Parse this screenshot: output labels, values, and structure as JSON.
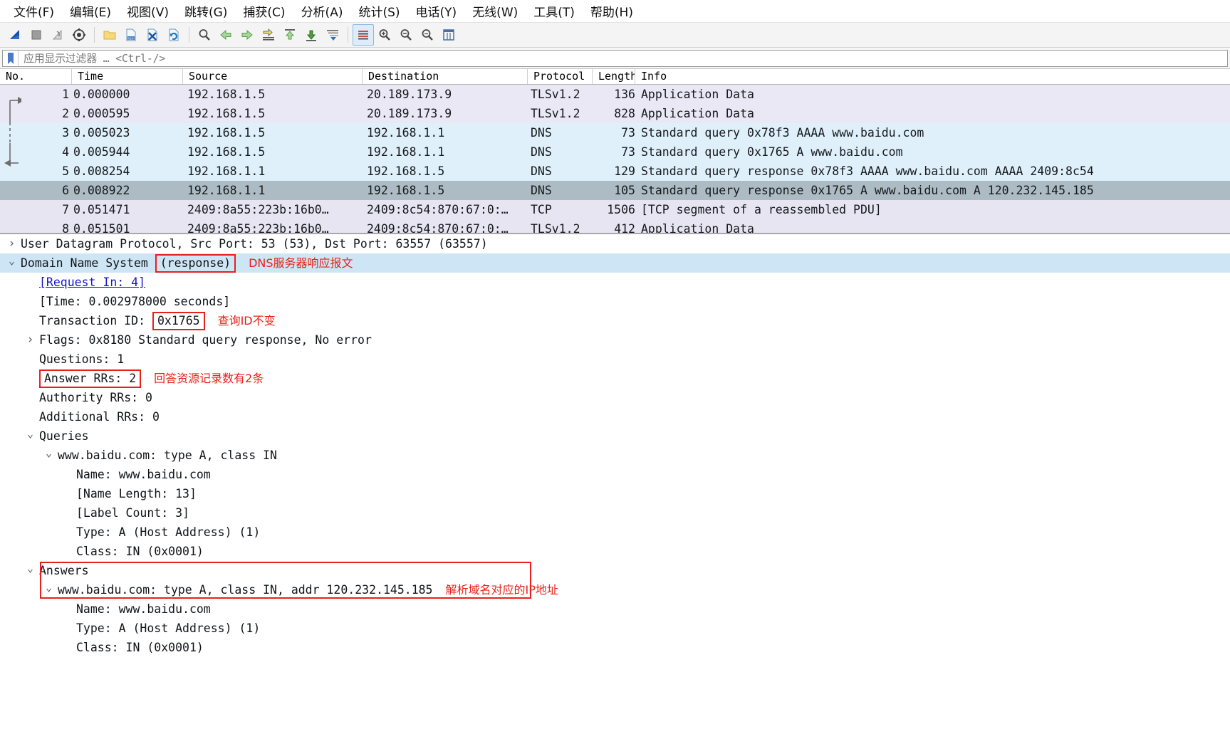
{
  "menu": {
    "items": [
      {
        "label": "文件(F)",
        "name": "menu-file"
      },
      {
        "label": "编辑(E)",
        "name": "menu-edit"
      },
      {
        "label": "视图(V)",
        "name": "menu-view"
      },
      {
        "label": "跳转(G)",
        "name": "menu-go"
      },
      {
        "label": "捕获(C)",
        "name": "menu-capture"
      },
      {
        "label": "分析(A)",
        "name": "menu-analyze"
      },
      {
        "label": "统计(S)",
        "name": "menu-statistics"
      },
      {
        "label": "电话(Y)",
        "name": "menu-telephony"
      },
      {
        "label": "无线(W)",
        "name": "menu-wireless"
      },
      {
        "label": "工具(T)",
        "name": "menu-tools"
      },
      {
        "label": "帮助(H)",
        "name": "menu-help"
      }
    ]
  },
  "toolbar": {
    "icons": [
      "start-capture-icon",
      "stop-capture-icon",
      "restart-capture-icon",
      "capture-options-icon",
      "open-file-icon",
      "save-file-icon",
      "close-file-icon",
      "reload-file-icon",
      "find-packet-icon",
      "go-back-icon",
      "go-forward-icon",
      "go-to-packet-icon",
      "go-first-packet-icon",
      "go-last-packet-icon",
      "auto-scroll-icon",
      "colorize-icon",
      "zoom-in-icon",
      "zoom-out-icon",
      "zoom-reset-icon",
      "resize-columns-icon"
    ]
  },
  "filter": {
    "placeholder": "应用显示过滤器 … <Ctrl-/>",
    "value": "",
    "bookmark_icon": "bookmark-icon"
  },
  "packet_list": {
    "columns": [
      "No.",
      "Time",
      "Source",
      "Destination",
      "Protocol",
      "Length",
      "Info"
    ],
    "rows": [
      {
        "no": "1",
        "time": "0.000000",
        "src": "192.168.1.5",
        "dst": "20.189.173.9",
        "proto": "TLSv1.2",
        "len": "136",
        "info": "Application Data",
        "style": "tls"
      },
      {
        "no": "2",
        "time": "0.000595",
        "src": "192.168.1.5",
        "dst": "20.189.173.9",
        "proto": "TLSv1.2",
        "len": "828",
        "info": "Application Data",
        "style": "tls"
      },
      {
        "no": "3",
        "time": "0.005023",
        "src": "192.168.1.5",
        "dst": "192.168.1.1",
        "proto": "DNS",
        "len": "73",
        "info": "Standard query 0x78f3 AAAA www.baidu.com",
        "style": "dns"
      },
      {
        "no": "4",
        "time": "0.005944",
        "src": "192.168.1.5",
        "dst": "192.168.1.1",
        "proto": "DNS",
        "len": "73",
        "info": "Standard query 0x1765 A www.baidu.com",
        "style": "dns"
      },
      {
        "no": "5",
        "time": "0.008254",
        "src": "192.168.1.1",
        "dst": "192.168.1.5",
        "proto": "DNS",
        "len": "129",
        "info": "Standard query response 0x78f3 AAAA www.baidu.com AAAA 2409:8c54",
        "style": "dns"
      },
      {
        "no": "6",
        "time": "0.008922",
        "src": "192.168.1.1",
        "dst": "192.168.1.5",
        "proto": "DNS",
        "len": "105",
        "info": "Standard query response 0x1765 A www.baidu.com A 120.232.145.185",
        "style": "sel"
      },
      {
        "no": "7",
        "time": "0.051471",
        "src": "2409:8a55:223b:16b0…",
        "dst": "2409:8c54:870:67:0:…",
        "proto": "TCP",
        "len": "1506",
        "info": "[TCP segment of a reassembled PDU]",
        "style": "tcp"
      },
      {
        "no": "8",
        "time": "0.051501",
        "src": "2409:8a55:223b:16b0…",
        "dst": "2409:8c54:870:67:0:…",
        "proto": "TLSv1.2",
        "len": "412",
        "info": "Application Data",
        "style": "tcp"
      }
    ]
  },
  "detail": {
    "rows": [
      {
        "indent": 0,
        "twisty": "›",
        "text": "User Datagram Protocol, Src Port: 53 (53), Dst Port: 63557 (63557)",
        "name": "detail-udp"
      },
      {
        "indent": 0,
        "twisty": "⌄",
        "text": "Domain Name System ",
        "boxed": "(response)",
        "annot": "DNS服务器响应报文",
        "selected": true,
        "name": "detail-dns"
      },
      {
        "indent": 1,
        "twisty": "",
        "text": "[Request In: 4]",
        "link": true,
        "name": "detail-request-in"
      },
      {
        "indent": 1,
        "twisty": "",
        "text": "[Time: 0.002978000 seconds]",
        "name": "detail-time"
      },
      {
        "indent": 1,
        "twisty": "",
        "text": "Transaction ID: ",
        "boxed": "0x1765",
        "annot": "查询ID不变",
        "name": "detail-transaction-id"
      },
      {
        "indent": 1,
        "twisty": "›",
        "text": "Flags: 0x8180 Standard query response, No error",
        "name": "detail-flags"
      },
      {
        "indent": 1,
        "twisty": "",
        "text": "Questions: 1",
        "name": "detail-questions"
      },
      {
        "indent": 1,
        "twisty": "",
        "boxed_full": "Answer RRs: 2",
        "annot": "回答资源记录数有2条",
        "name": "detail-answer-rrs"
      },
      {
        "indent": 1,
        "twisty": "",
        "text": "Authority RRs: 0",
        "name": "detail-authority-rrs"
      },
      {
        "indent": 1,
        "twisty": "",
        "text": "Additional RRs: 0",
        "name": "detail-additional-rrs"
      },
      {
        "indent": 1,
        "twisty": "⌄",
        "text": "Queries",
        "name": "detail-queries"
      },
      {
        "indent": 2,
        "twisty": "⌄",
        "text": "www.baidu.com: type A, class IN",
        "name": "detail-query-entry"
      },
      {
        "indent": 3,
        "twisty": "",
        "text": "Name: www.baidu.com",
        "name": "detail-query-name"
      },
      {
        "indent": 3,
        "twisty": "",
        "text": "[Name Length: 13]",
        "name": "detail-query-name-length"
      },
      {
        "indent": 3,
        "twisty": "",
        "text": "[Label Count: 3]",
        "name": "detail-query-label-count"
      },
      {
        "indent": 3,
        "twisty": "",
        "text": "Type: A (Host Address) (1)",
        "name": "detail-query-type"
      },
      {
        "indent": 3,
        "twisty": "",
        "text": "Class: IN (0x0001)",
        "name": "detail-query-class"
      },
      {
        "indent": 1,
        "twisty": "⌄",
        "text": "Answers",
        "annot": "",
        "name": "detail-answers"
      },
      {
        "indent": 2,
        "twisty": "⌄",
        "text": "www.baidu.com: type A, class IN, addr 120.232.145.185",
        "annot": "解析域名对应的IP地址",
        "name": "detail-answer-entry"
      },
      {
        "indent": 3,
        "twisty": "",
        "text": "Name: www.baidu.com",
        "name": "detail-answer-name"
      },
      {
        "indent": 3,
        "twisty": "",
        "text": "Type: A (Host Address) (1)",
        "name": "detail-answer-type"
      },
      {
        "indent": 3,
        "twisty": "",
        "text": "Class: IN (0x0001)",
        "name": "detail-answer-class"
      }
    ]
  },
  "colors": {
    "annotation_red": "#e8201a",
    "selected_row": "#adbcc4",
    "dns_row": "#dff0fb",
    "tls_row": "#eae8f5",
    "detail_selected": "#cde5f5",
    "link_blue": "#1a17c9"
  }
}
